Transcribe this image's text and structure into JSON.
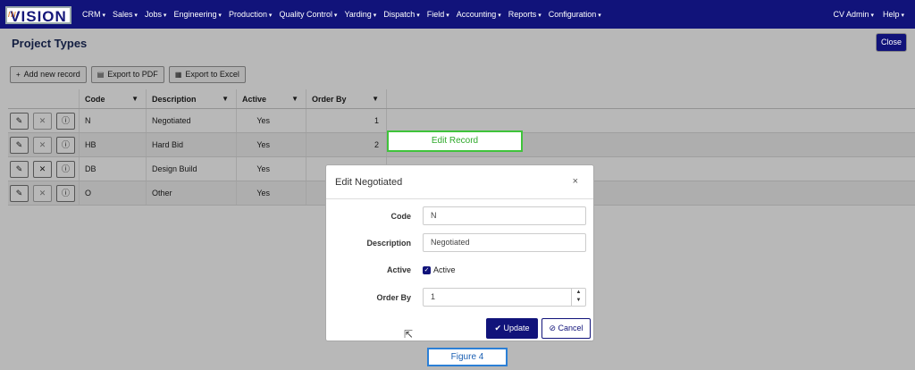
{
  "app": {
    "logo_text": "VISION",
    "logo_accent": "///"
  },
  "nav": {
    "items": [
      "CRM",
      "Sales",
      "Jobs",
      "Engineering",
      "Production",
      "Quality Control",
      "Yarding",
      "Dispatch",
      "Field",
      "Accounting",
      "Reports",
      "Configuration"
    ],
    "user": "CV Admin",
    "help": "Help"
  },
  "page": {
    "title": "Project Types",
    "close_label": "Close"
  },
  "toolbar": {
    "add_label": "Add new record",
    "pdf_label": "Export to PDF",
    "excel_label": "Export to Excel"
  },
  "grid": {
    "columns": [
      "Code",
      "Description",
      "Active",
      "Order By"
    ],
    "rows": [
      {
        "code": "N",
        "description": "Negotiated",
        "active": "Yes",
        "order": "1"
      },
      {
        "code": "HB",
        "description": "Hard Bid",
        "active": "Yes",
        "order": "2"
      },
      {
        "code": "DB",
        "description": "Design Build",
        "active": "Yes",
        "order": ""
      },
      {
        "code": "O",
        "description": "Other",
        "active": "Yes",
        "order": ""
      }
    ]
  },
  "callouts": {
    "edit_record": "Edit Record",
    "figure": "Figure 4"
  },
  "modal": {
    "title": "Edit Negotiated",
    "close_glyph": "×",
    "code_label": "Code",
    "code_value": "N",
    "desc_label": "Description",
    "desc_value": "Negotiated",
    "active_label": "Active",
    "active_check_label": "Active",
    "order_label": "Order By",
    "order_value": "1",
    "update_label": "Update",
    "cancel_label": "Cancel"
  },
  "colors": {
    "nav_bg": "#11137a",
    "green_callout": "#3fc33b",
    "blue_callout": "#2b7fd6"
  }
}
